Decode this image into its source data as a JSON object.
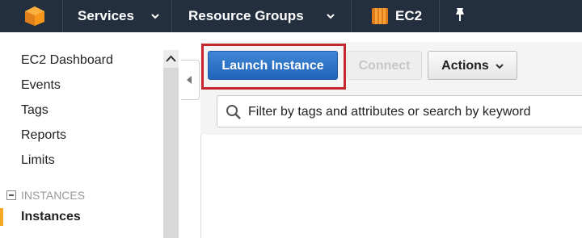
{
  "topbar": {
    "services_label": "Services",
    "resource_groups_label": "Resource Groups",
    "ec2_label": "EC2",
    "bg_color": "#232f3e"
  },
  "sidebar": {
    "items": [
      {
        "label": "EC2 Dashboard"
      },
      {
        "label": "Events"
      },
      {
        "label": "Tags"
      },
      {
        "label": "Reports"
      },
      {
        "label": "Limits"
      }
    ],
    "section_label": "INSTANCES",
    "active_item": "Instances",
    "active_color": "#f5a623"
  },
  "toolbar": {
    "launch_label": "Launch Instance",
    "connect_label": "Connect",
    "actions_label": "Actions",
    "highlight_color": "#c4262e"
  },
  "filter": {
    "placeholder": "Filter by tags and attributes or search by keyword"
  }
}
